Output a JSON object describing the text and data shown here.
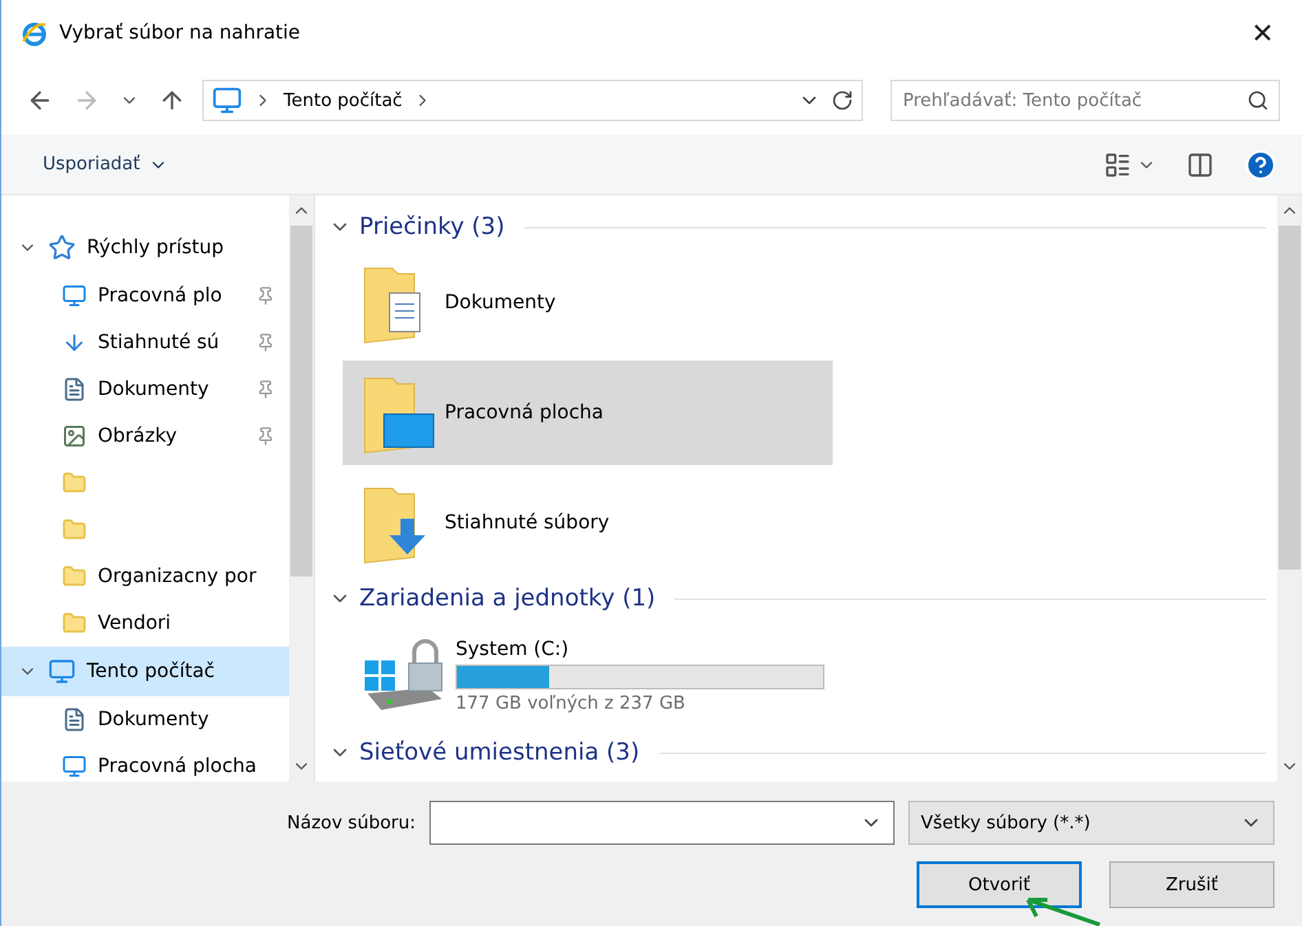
{
  "window": {
    "title": "Vybrať súbor na nahratie",
    "close": "✕"
  },
  "address": {
    "path": "Tento počítač",
    "search_placeholder": "Prehľadávať: Tento počítač"
  },
  "toolbar": {
    "organize": "Usporiadať"
  },
  "sidebar": {
    "items": [
      {
        "kind": "quick_access",
        "label": "Rýchly prístup",
        "expanded": true,
        "selected": false,
        "children": [
          {
            "kind": "desktop",
            "label": "Pracovná plo",
            "pinned": true
          },
          {
            "kind": "download",
            "label": "Stiahnuté sú",
            "pinned": true
          },
          {
            "kind": "document",
            "label": "Dokumenty",
            "pinned": true
          },
          {
            "kind": "picture",
            "label": "Obrázky",
            "pinned": true
          },
          {
            "kind": "folder",
            "pinned": false
          },
          {
            "kind": "folder",
            "pinned": false
          },
          {
            "kind": "folder",
            "label": "Organizacny por",
            "pinned": false
          },
          {
            "kind": "folder",
            "label": "Vendori",
            "pinned": false
          }
        ]
      },
      {
        "kind": "computer",
        "label": "Tento počítač",
        "expanded": true,
        "selected": true,
        "children": [
          {
            "kind": "document",
            "label": "Dokumenty",
            "pinned": false
          },
          {
            "kind": "desktop",
            "label": "Pracovná plocha",
            "pinned": false
          }
        ]
      }
    ]
  },
  "content": {
    "sections": [
      {
        "title": "Priečinky (3)",
        "kind": "folders",
        "items": [
          {
            "name": "Dokumenty",
            "kind": "document",
            "selected": false
          },
          {
            "name": "Pracovná plocha",
            "kind": "desktop",
            "selected": true
          },
          {
            "name": "Stiahnuté súbory",
            "kind": "download",
            "selected": false
          }
        ]
      },
      {
        "title": "Zariadenia a jednotky (1)",
        "kind": "drives",
        "items": [
          {
            "name": "System (C:)",
            "level": 0.25,
            "free": "177 GB voľných z 237 GB"
          }
        ]
      },
      {
        "title": "Sieťové umiestnenia (3)",
        "kind": "network"
      }
    ]
  },
  "footer": {
    "filename_label": "Názov súboru:",
    "filter": "Všetky súbory (*.*)",
    "open": "Otvoriť",
    "cancel": "Zrušiť"
  }
}
